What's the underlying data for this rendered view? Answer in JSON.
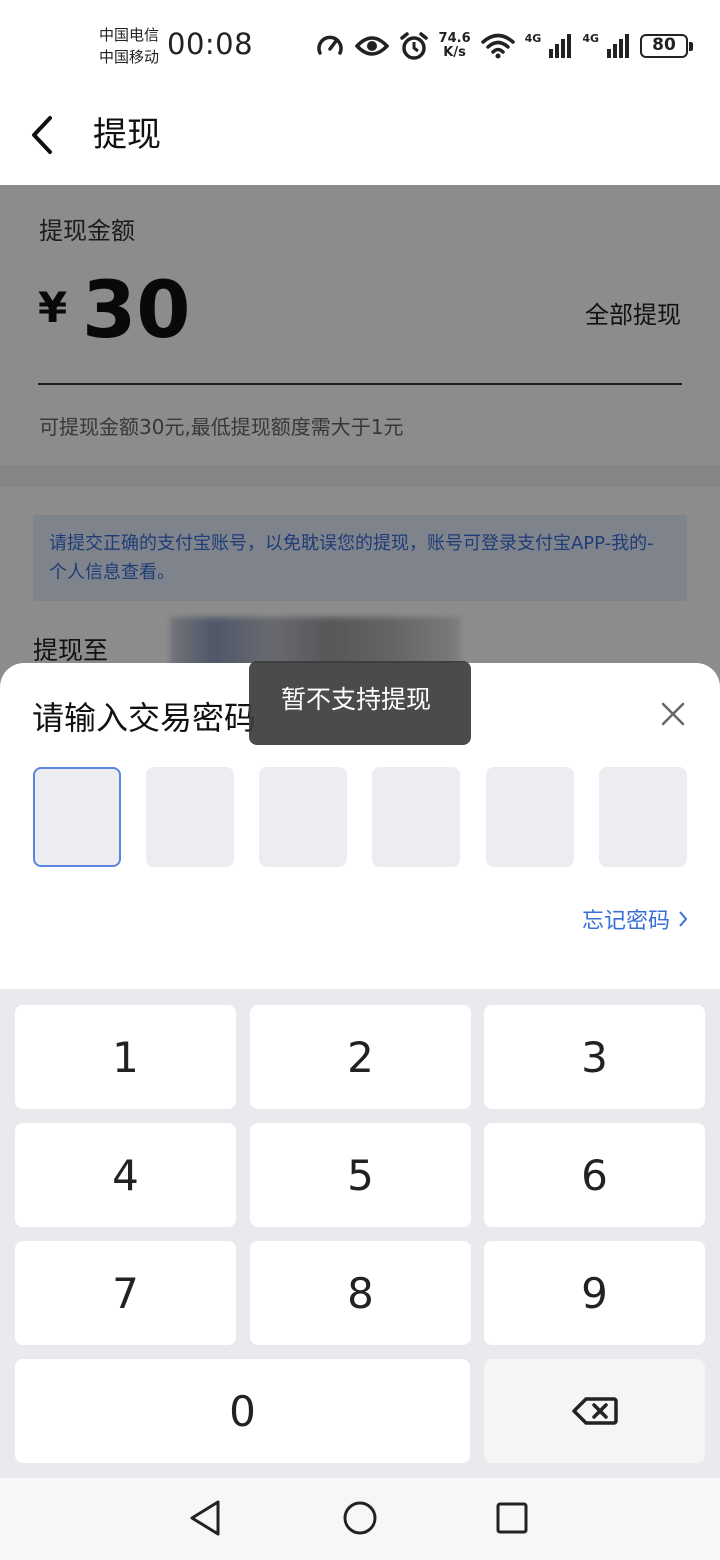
{
  "status_bar": {
    "carrier_1": "中国电信",
    "carrier_2": "中国移动",
    "time": "00:08",
    "net_speed_value": "74.6",
    "net_speed_unit": "K/s",
    "signal_1_label": "4G",
    "signal_2_label": "4G",
    "battery": "80"
  },
  "nav": {
    "title": "提现"
  },
  "amount_card": {
    "label": "提现金额",
    "currency": "¥",
    "amount": "30",
    "withdraw_all": "全部提现",
    "hint": "可提现金额30元,最低提现额度需大于1元"
  },
  "notice": {
    "text": "请提交正确的支付宝账号，以免耽误您的提现，账号可登录支付宝APP-我的-个人信息查看。"
  },
  "withdraw_to": {
    "label": "提现至"
  },
  "password_sheet": {
    "title": "请输入交易密码",
    "forgot": "忘记密码",
    "pin_length": 6
  },
  "keypad": {
    "keys": [
      "1",
      "2",
      "3",
      "4",
      "5",
      "6",
      "7",
      "8",
      "9",
      "0"
    ]
  },
  "toast": {
    "text": "暂不支持提现"
  },
  "colors": {
    "accent": "#3a6fd8",
    "active_border": "#5a86e0"
  }
}
